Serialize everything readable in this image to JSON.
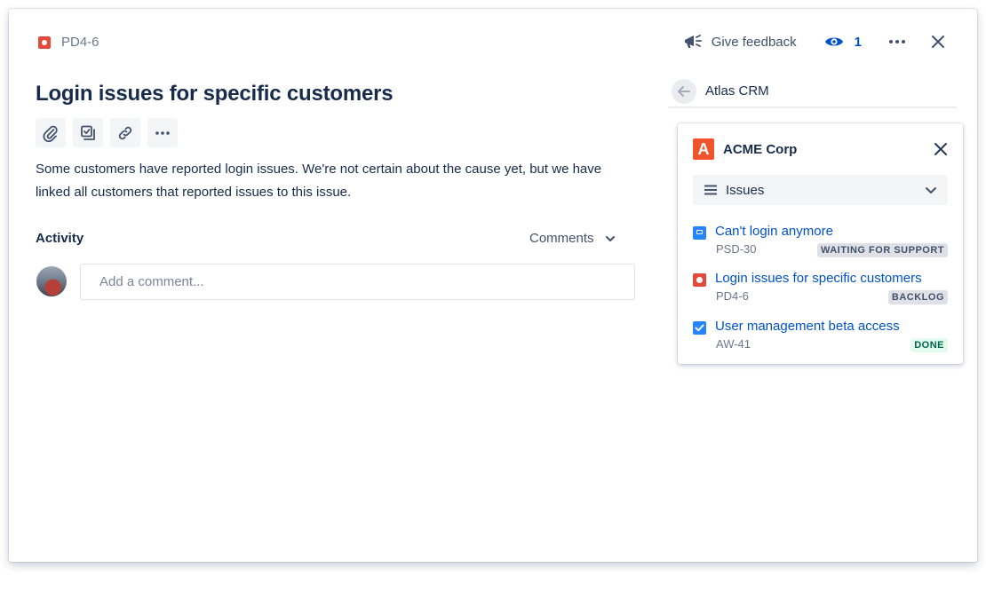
{
  "header": {
    "issue_key": "PD4-6",
    "feedback_label": "Give feedback",
    "watch_count": "1"
  },
  "issue": {
    "title": "Login issues for specific customers",
    "description": "Some customers have reported login issues. We're not certain about the cause yet, but we have linked all customers that reported issues to this issue."
  },
  "toolbar": {
    "icons": [
      "paperclip-icon",
      "subtask-icon",
      "link-icon",
      "more-icon"
    ]
  },
  "activity": {
    "label": "Activity",
    "filter_value": "Comments",
    "comment_placeholder": "Add a comment..."
  },
  "panel": {
    "app_name": "Atlas CRM",
    "company": {
      "logo_letter": "A",
      "name": "ACME Corp",
      "brand_color": "#f0542c"
    },
    "select_value": "Issues",
    "issues": [
      {
        "name": "Can't login anymore",
        "key": "PSD-30",
        "status": "WAITING FOR SUPPORT",
        "status_bg": "#dfe1e6",
        "status_color": "#42526e",
        "type": "support-icon"
      },
      {
        "name": "Login issues for specific customers",
        "key": "PD4-6",
        "status": "BACKLOG",
        "status_bg": "#dfe1e6",
        "status_color": "#42526e",
        "type": "bug-icon"
      },
      {
        "name": "User management beta access",
        "key": "AW-41",
        "status": "DONE",
        "status_bg": "#e3fcef",
        "status_color": "#006644",
        "type": "task-icon"
      }
    ]
  },
  "colors": {
    "link": "#0052cc",
    "text": "#172b4d",
    "subtle": "#6b778c"
  }
}
